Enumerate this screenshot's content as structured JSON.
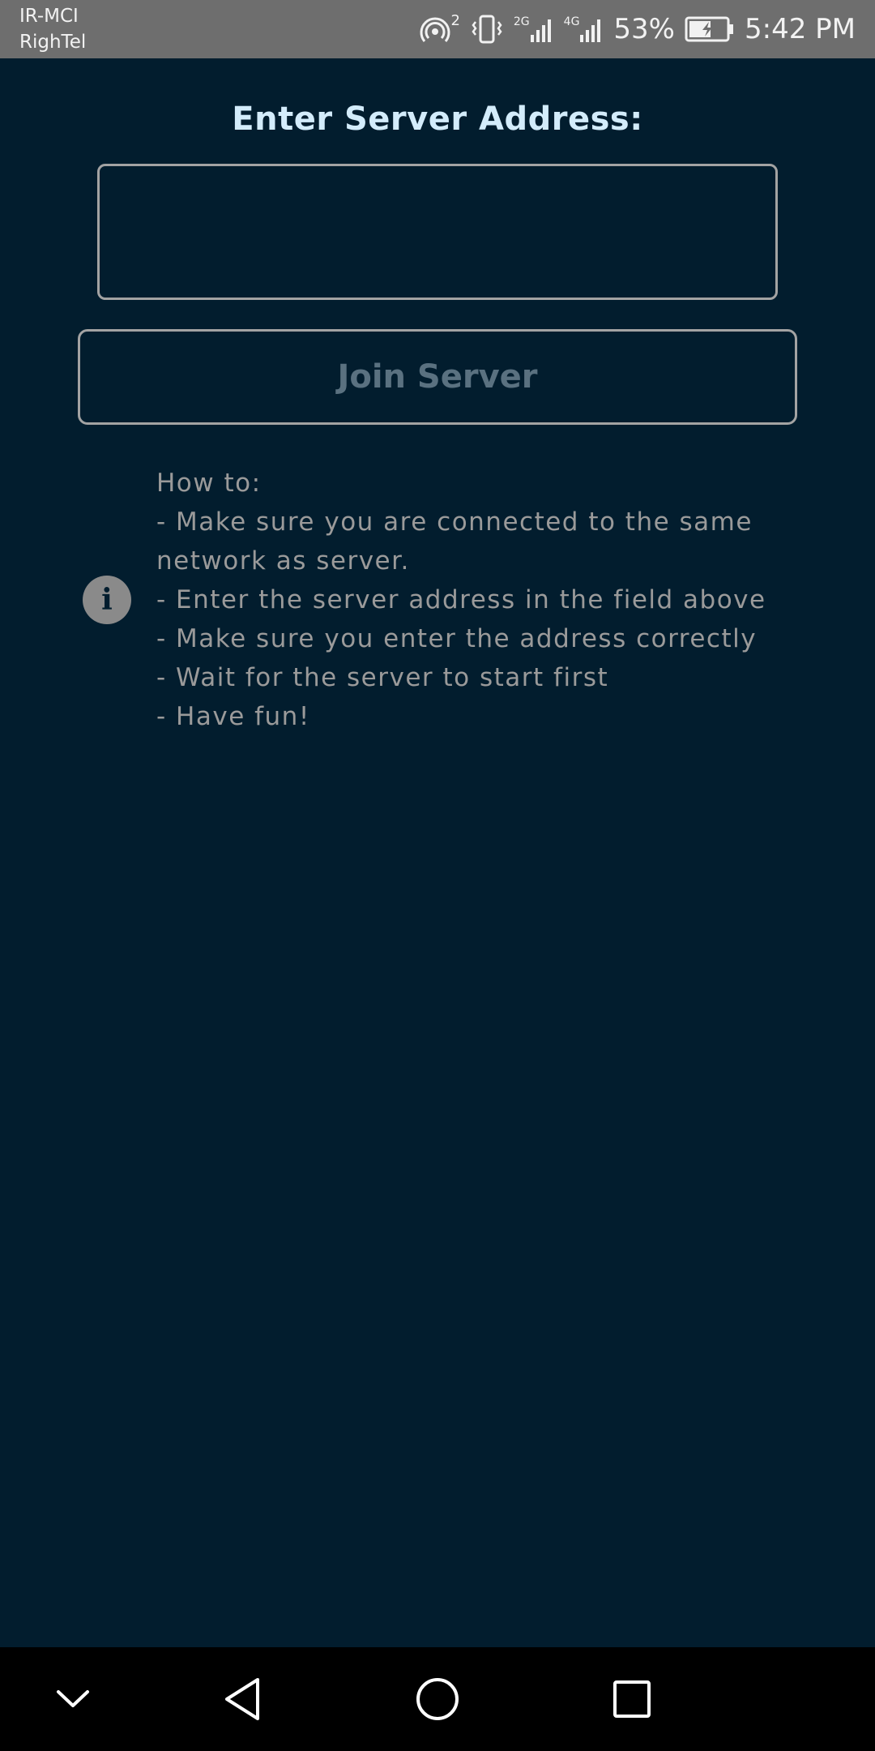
{
  "status_bar": {
    "carrier_1": "IR-MCI",
    "carrier_2": "RighTel",
    "hotspot_count": "2",
    "network_2g": "2G",
    "network_4g": "4G",
    "battery": "53%",
    "time": "5:42 PM"
  },
  "main": {
    "title": "Enter Server Address:",
    "address_input": {
      "value": "",
      "placeholder": ""
    },
    "join_button_label": "Join Server",
    "info_icon_glyph": "i",
    "howto_lines": [
      "How to:",
      "- Make sure you are connected to the same",
      "network as server.",
      "- Enter the server address in the field above",
      "- Make sure you enter the address correctly",
      "- Wait for the server to start first",
      "- Have fun!"
    ]
  },
  "nav_bar": {
    "icons": [
      "chevron-down-icon",
      "back-icon",
      "home-icon",
      "recents-icon"
    ]
  },
  "colors": {
    "background": "#021d2e",
    "title": "#d3ecfb",
    "button_text_disabled": "#5a7180",
    "border": "#a3a3a3",
    "body_text": "#9a9a9a",
    "status_bar": "#6e6e6e",
    "nav_bar": "#000000"
  }
}
